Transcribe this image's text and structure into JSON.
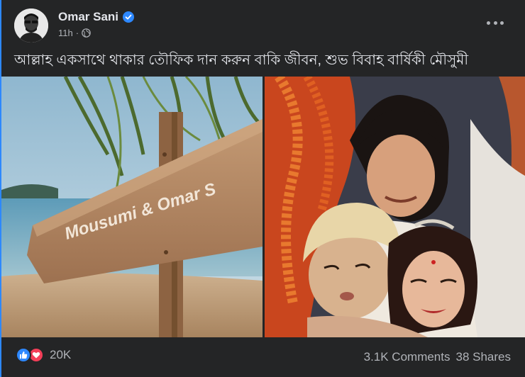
{
  "post": {
    "author": "Omar Sani",
    "time": "11h",
    "separator": "·",
    "caption": "আল্লাহ একসাথে থাকার তৌফিক দান করুন বাকি জীবন, শুভ বিবাহ বার্ষিকী মৌসুমী"
  },
  "photo_left": {
    "sign_text": "Mousumi & Omar S"
  },
  "footer": {
    "reaction_count": "20K",
    "comments": "3.1K Comments",
    "shares": "38 Shares"
  },
  "colors": {
    "accent": "#2d88ff",
    "love": "#f33e58",
    "card_bg": "#242526"
  },
  "icons": [
    "verified-badge-icon",
    "globe-icon",
    "more-options-icon",
    "like-reaction-icon",
    "love-reaction-icon"
  ]
}
